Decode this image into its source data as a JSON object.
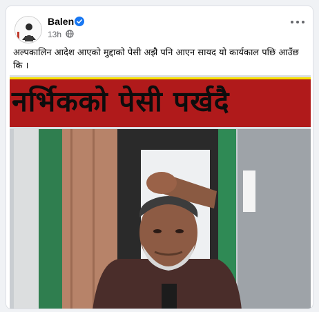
{
  "post": {
    "author": "Balen",
    "timestamp": "13h",
    "caption": "अल्पकालिन आदेश आएको मुद्दाको पेसी अझै पनि आएन सायद यो कार्यकाल पछि आउँछ कि ।",
    "image_banner_text": "नर्भिकको पेसी पर्खदै"
  },
  "icons": {
    "verified": "verified-badge-icon",
    "privacy": "globe-icon",
    "more": "more-options-icon"
  },
  "colors": {
    "verified": "#1877f2",
    "banner_bg": "#b01a1b",
    "banner_border": "#f6e000",
    "window_frame": "#2e8b57"
  }
}
